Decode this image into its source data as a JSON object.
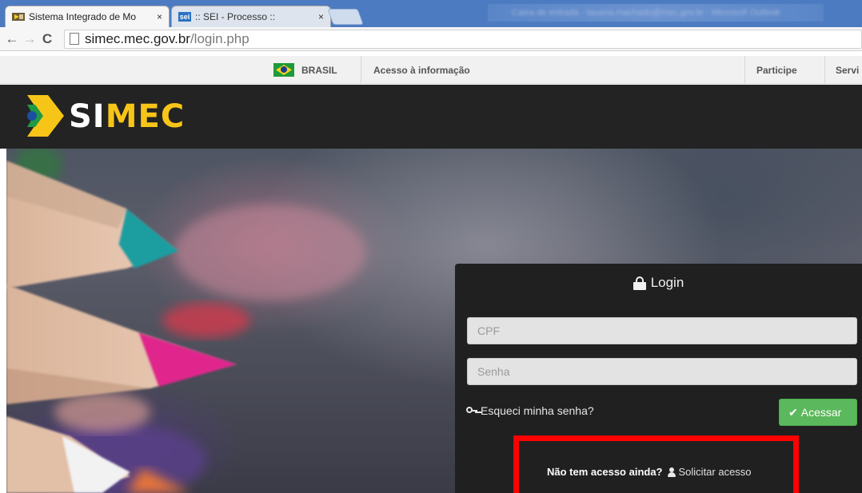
{
  "browser": {
    "tabs": [
      {
        "title": "Sistema Integrado de Mo",
        "close": "×",
        "active": true
      },
      {
        "title": ":: SEI - Processo ::",
        "favicon_text": "sei",
        "close": "×",
        "active": false
      }
    ],
    "blurred_text": "Caixa de entrada - tauana.machado@mec.gov.br - Microsoft Outlook",
    "url_host": "simec.mec.gov.br",
    "url_path": "/login.php",
    "nav": {
      "back": "←",
      "forward": "→",
      "reload": "C"
    }
  },
  "govbar": {
    "brasil": "BRASIL",
    "acesso": "Acesso à informação",
    "participe": "Participe",
    "servicos": "Servi"
  },
  "header": {
    "logo_part1": "SI",
    "logo_part2": "MEC"
  },
  "login": {
    "title": "Login",
    "cpf_placeholder": "CPF",
    "senha_placeholder": "Senha",
    "forgot": "Esqueci minha senha?",
    "submit": "Acessar",
    "check": "✔",
    "no_access": "Não tem acesso ainda?",
    "request": "Solicitar acesso"
  },
  "colors": {
    "accent_yellow": "#f7c518",
    "button_green": "#5cb85c",
    "highlight_red": "#ff0000",
    "header_bg": "#232323"
  }
}
